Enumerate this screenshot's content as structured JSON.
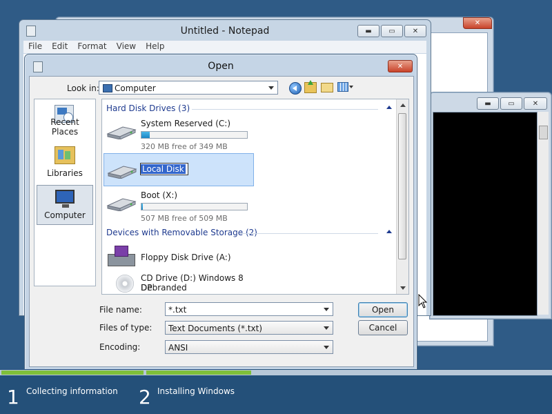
{
  "notepad": {
    "title": "Untitled - Notepad",
    "menu": [
      "File",
      "Edit",
      "Format",
      "View",
      "Help"
    ]
  },
  "dialog": {
    "title": "Open",
    "look_in_label": "Look in:",
    "look_in_value": "Computer",
    "places": [
      {
        "label": "Recent Places",
        "icon": "recent-places-icon"
      },
      {
        "label": "Libraries",
        "icon": "libraries-icon"
      },
      {
        "label": "Computer",
        "icon": "computer-icon",
        "selected": true
      }
    ],
    "groups": {
      "hdd": {
        "header": "Hard Disk Drives (3)",
        "drives": [
          {
            "name": "System Reserved (C:)",
            "free": "320 MB free of 349 MB",
            "used_fraction": 0.08
          },
          {
            "name": "Local Disk",
            "renaming": true
          },
          {
            "name": "Boot (X:)",
            "free": "507 MB free of 509 MB",
            "used_fraction": 0.004
          }
        ]
      },
      "removable": {
        "header": "Devices with Removable Storage (2)",
        "devices": [
          {
            "name": "Floppy Disk Drive (A:)",
            "icon": "floppy-icon"
          },
          {
            "name": "CD Drive (D:) Windows 8 DP",
            "name_line2": "Debranded",
            "icon": "cd-drive-icon"
          }
        ]
      }
    },
    "file_name_label": "File name:",
    "file_name_value": "*.txt",
    "file_type_label": "Files of type:",
    "file_type_value": "Text Documents (*.txt)",
    "encoding_label": "Encoding:",
    "encoding_value": "ANSI",
    "open_button": "Open",
    "cancel_button": "Cancel"
  },
  "setup": {
    "steps": [
      {
        "number": "1",
        "label": "Collecting information"
      },
      {
        "number": "2",
        "label": "Installing Windows"
      }
    ]
  },
  "colors": {
    "desktop": "#2f5b86",
    "progress_fill": "#7fbf3a",
    "group_header": "#1e3a8f"
  }
}
